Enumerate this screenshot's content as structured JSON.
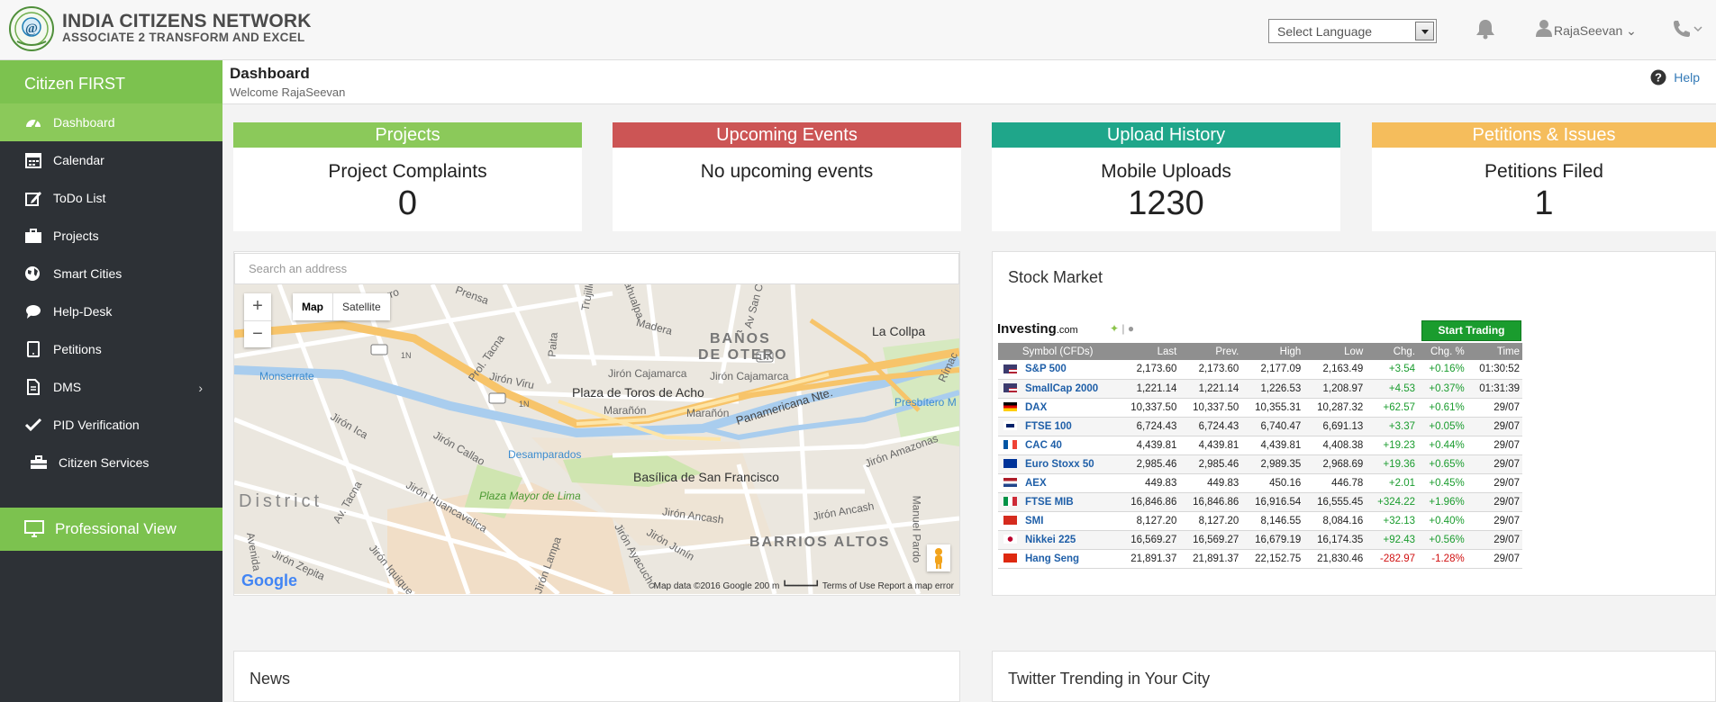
{
  "header": {
    "brand_title": "INDIA CITIZENS NETWORK",
    "brand_subtitle": "ASSOCIATE 2 TRANSFORM AND EXCEL",
    "language_select": "Select Language",
    "user_name": "RajaSeevan ⌄"
  },
  "sidebar": {
    "brand": "Citizen FIRST",
    "items": [
      {
        "label": "Dashboard",
        "icon": "dashboard-icon"
      },
      {
        "label": "Calendar",
        "icon": "calendar-icon"
      },
      {
        "label": "ToDo List",
        "icon": "edit-icon"
      },
      {
        "label": "Projects",
        "icon": "briefcase-icon"
      },
      {
        "label": "Smart Cities",
        "icon": "globe-icon"
      },
      {
        "label": "Help-Desk",
        "icon": "comment-icon"
      },
      {
        "label": "Petitions",
        "icon": "tablet-icon"
      },
      {
        "label": "DMS",
        "icon": "file-icon"
      },
      {
        "label": "PID Verification",
        "icon": "check-icon"
      },
      {
        "label": "Citizen Services",
        "icon": "toolbox-icon"
      }
    ],
    "professional_view": "Professional View"
  },
  "page": {
    "title": "Dashboard",
    "welcome": "Welcome RajaSeevan",
    "help": "Help"
  },
  "cards": [
    {
      "header": "Projects",
      "label": "Project Complaints",
      "value": "0",
      "color": "#8bc95a"
    },
    {
      "header": "Upcoming Events",
      "label": "No upcoming events",
      "value": "",
      "color": "#cc5555"
    },
    {
      "header": "Upload History",
      "label": "Mobile Uploads",
      "value": "1230",
      "color": "#1fa68a"
    },
    {
      "header": "Petitions & Issues",
      "label": "Petitions Filed",
      "value": "1",
      "color": "#f5bd5c"
    }
  ],
  "map": {
    "search_placeholder": "Search an address",
    "zoom_in": "+",
    "zoom_out": "−",
    "type_map": "Map",
    "type_satellite": "Satellite",
    "labels": {
      "pizarro": "Jr. Pizarro",
      "prensa": "Prensa",
      "trujillo": "Trujillo",
      "atahualpa": "Atahualpa",
      "madera": "Madera",
      "san_cristobal": "Av San Cr",
      "banos": "BAÑOS",
      "de_otero": "DE OTERO",
      "la_collpa": "La Collpa",
      "tacna": "Prol. Tacna",
      "paita": "Paita",
      "rimac": "Rímac",
      "monserrate": "Monserrate",
      "viru": "Jirón Viru",
      "cajamarca1": "Jirón Cajamarca",
      "cajamarca2": "Jirón Cajamarca",
      "toros": "Plaza de Toros de Acho",
      "maranon1": "Marañón",
      "maranon2": "Marañón",
      "panamericana": "Panamericana Nte.",
      "presbitero": "Presbítero M",
      "ica": "Jirón Ica",
      "callao": "Jirón Callao",
      "desamparados": "Desamparados",
      "amazonas": "Jirón Amazonas",
      "san_francisco": "Basílica de San Francisco",
      "district": "District",
      "av_tacna": "Av. Tacna",
      "huancavelica": "Jirón Huancavelica",
      "plaza_mayor": "Plaza Mayor de Lima",
      "ancash1": "Jirón Ancash",
      "ancash2": "Jirón Ancash",
      "junin": "Jirón Junín",
      "ayacucho": "Jirón Ayacucho",
      "barrios": "BARRIOS ALTOS",
      "manuel": "Manuel Pardo",
      "avenida": "Avenida",
      "zepita": "Jirón Zepita",
      "lampa": "Jirón Lampa",
      "iquique": "Jirón Iquique",
      "route1": "1N",
      "route2": "1N",
      "route3": "1N"
    },
    "google": "Google",
    "attribution": "Map data ©2016 Google   200 m ┗━━━━━┛   Terms of Use   Report a map error"
  },
  "stock": {
    "title": "Stock Market",
    "logo": "Investing",
    "logo_suffix": ".com",
    "icons": "✦ | ",
    "start_trading": "Start Trading",
    "columns": [
      "Symbol (CFDs)",
      "Last",
      "Prev.",
      "High",
      "Low",
      "Chg.",
      "Chg. %",
      "Time"
    ],
    "rows": [
      {
        "flag": "us",
        "symbol": "S&P 500",
        "last": "2,173.60",
        "prev": "2,173.60",
        "high": "2,177.09",
        "low": "2,163.49",
        "chg": "+3.54",
        "pct": "+0.16%",
        "time": "01:30:52"
      },
      {
        "flag": "us",
        "symbol": "SmallCap 2000",
        "last": "1,221.14",
        "prev": "1,221.14",
        "high": "1,226.53",
        "low": "1,208.97",
        "chg": "+4.53",
        "pct": "+0.37%",
        "time": "01:31:39"
      },
      {
        "flag": "de",
        "symbol": "DAX",
        "last": "10,337.50",
        "prev": "10,337.50",
        "high": "10,355.31",
        "low": "10,287.32",
        "chg": "+62.57",
        "pct": "+0.61%",
        "time": "29/07"
      },
      {
        "flag": "gb",
        "symbol": "FTSE 100",
        "last": "6,724.43",
        "prev": "6,724.43",
        "high": "6,740.47",
        "low": "6,691.13",
        "chg": "+3.37",
        "pct": "+0.05%",
        "time": "29/07"
      },
      {
        "flag": "fr",
        "symbol": "CAC 40",
        "last": "4,439.81",
        "prev": "4,439.81",
        "high": "4,439.81",
        "low": "4,408.38",
        "chg": "+19.23",
        "pct": "+0.44%",
        "time": "29/07"
      },
      {
        "flag": "eu",
        "symbol": "Euro Stoxx 50",
        "last": "2,985.46",
        "prev": "2,985.46",
        "high": "2,989.35",
        "low": "2,968.69",
        "chg": "+19.36",
        "pct": "+0.65%",
        "time": "29/07"
      },
      {
        "flag": "nl",
        "symbol": "AEX",
        "last": "449.83",
        "prev": "449.83",
        "high": "450.16",
        "low": "446.78",
        "chg": "+2.01",
        "pct": "+0.45%",
        "time": "29/07"
      },
      {
        "flag": "it",
        "symbol": "FTSE MIB",
        "last": "16,846.86",
        "prev": "16,846.86",
        "high": "16,916.54",
        "low": "16,555.45",
        "chg": "+324.22",
        "pct": "+1.96%",
        "time": "29/07"
      },
      {
        "flag": "ch",
        "symbol": "SMI",
        "last": "8,127.20",
        "prev": "8,127.20",
        "high": "8,146.55",
        "low": "8,084.16",
        "chg": "+32.13",
        "pct": "+0.40%",
        "time": "29/07"
      },
      {
        "flag": "jp",
        "symbol": "Nikkei 225",
        "last": "16,569.27",
        "prev": "16,569.27",
        "high": "16,679.19",
        "low": "16,174.35",
        "chg": "+92.43",
        "pct": "+0.56%",
        "time": "29/07"
      },
      {
        "flag": "hk",
        "symbol": "Hang Seng",
        "last": "21,891.37",
        "prev": "21,891.37",
        "high": "22,152.75",
        "low": "21,830.46",
        "chg": "-282.97",
        "pct": "-1.28%",
        "time": "29/07"
      }
    ]
  },
  "bottom": {
    "news_title": "News",
    "twitter_title": "Twitter Trending in Your City"
  },
  "colors": {
    "accent_green": "#7cc24f",
    "sidebar_bg": "#2d3136",
    "link_blue": "#337ab7",
    "positive": "#1a9c2e",
    "negative": "#d01010"
  }
}
